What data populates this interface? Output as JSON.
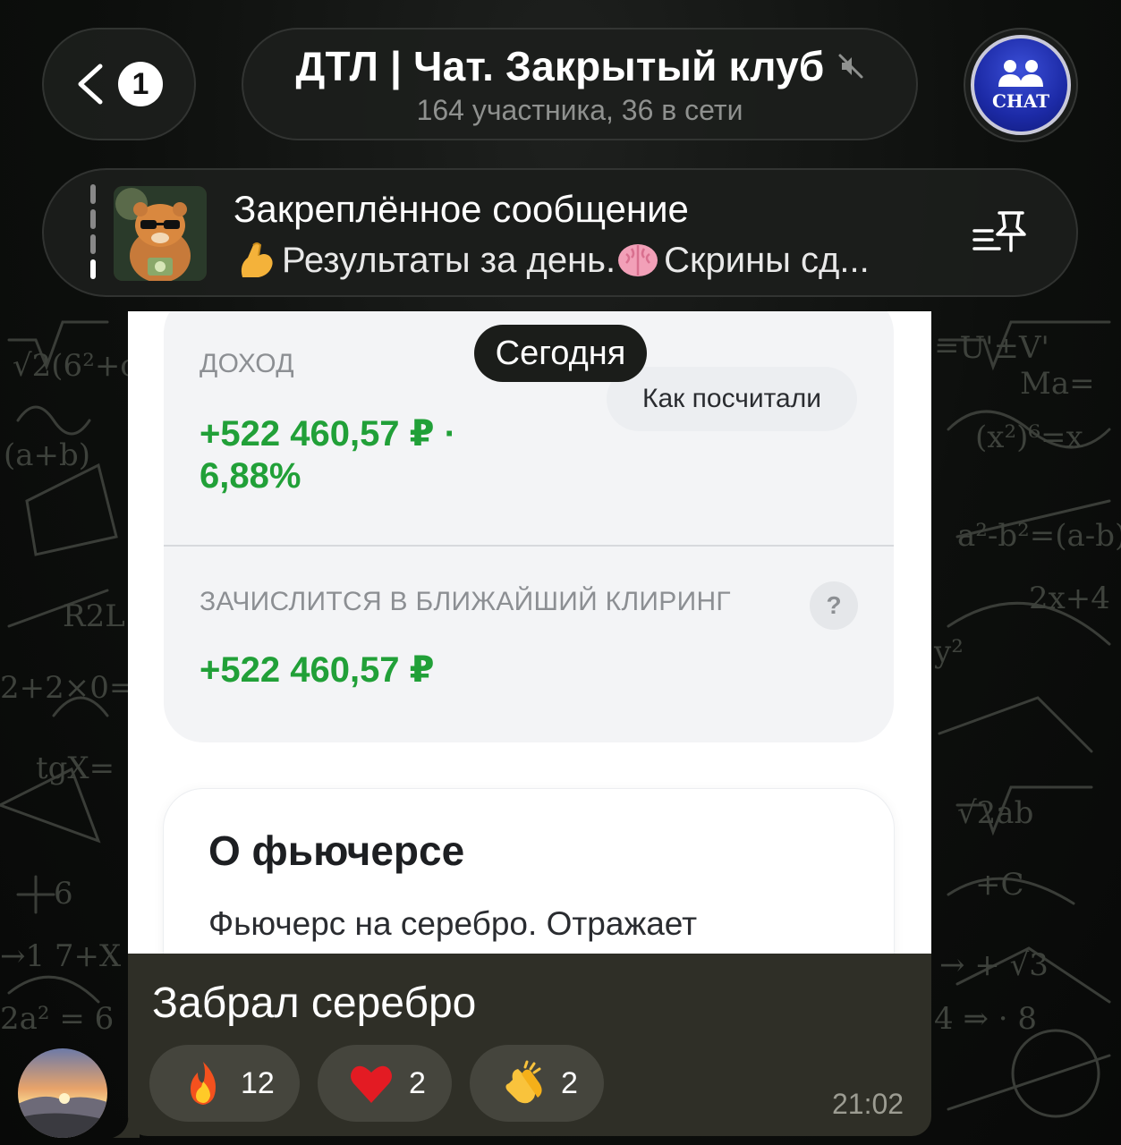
{
  "header": {
    "back_badge": "1",
    "title": "ДТЛ | Чат. Закрытый клуб",
    "subtitle": "164 участника, 36 в сети",
    "avatar_text": "CHAT"
  },
  "pinned": {
    "title": "Закреплённое сообщение",
    "text_part1": "Результаты за день. ",
    "text_part2": "Скрины сд..."
  },
  "screenshot": {
    "date_chip": "Сегодня",
    "income_label": "ДОХОД",
    "income_value_line1": "+522 460,57 ₽ ·",
    "income_value_line2": "6,88%",
    "how_button": "Как посчитали",
    "clearing_label": "ЗАЧИСЛИТСЯ В БЛИЖАЙШИЙ КЛИРИНГ",
    "help_mark": "?",
    "clearing_value": "+522 460,57 ₽",
    "about_title": "О фьючерсе",
    "about_text": "Фьючерс на серебро. Отражает"
  },
  "message": {
    "text": "Забрал серебро",
    "time": "21:02",
    "reactions": [
      {
        "icon": "fire-emoji",
        "count": "12"
      },
      {
        "icon": "heart-emoji",
        "count": "2"
      },
      {
        "icon": "clapping-hands-emoji",
        "count": "2"
      }
    ]
  },
  "colors": {
    "green": "#21a038",
    "bubble": "#2f2f27",
    "bar": "#1c1e1c"
  }
}
